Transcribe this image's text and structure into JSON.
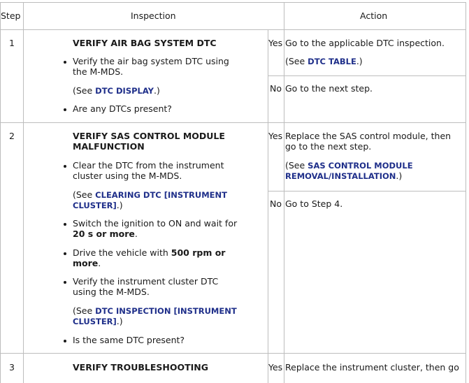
{
  "header": {
    "step": "Step",
    "inspection": "Inspection",
    "action": "Action"
  },
  "rows": [
    {
      "step": "1",
      "title": "VERIFY AIR BAG SYSTEM DTC",
      "b1": [
        "Verify the air bag system DTC using",
        "the M-MDS."
      ],
      "see1": {
        "pre": "(See ",
        "link": "DTC DISPLAY",
        "post": ".)"
      },
      "b2": "Are any DTCs present?",
      "yes_label": "Yes",
      "yes_text": "Go to the applicable DTC inspection.",
      "yes_see": {
        "pre": "(See ",
        "link": "DTC TABLE",
        "post": ".)"
      },
      "no_label": "No",
      "no_text": "Go to the next step."
    },
    {
      "step": "2",
      "title": [
        "VERIFY SAS CONTROL MODULE",
        "MALFUNCTION"
      ],
      "b1": [
        "Clear the DTC from the instrument",
        "cluster using the M-MDS."
      ],
      "see1": {
        "pre": "(See ",
        "link1": "CLEARING DTC [INSTRUMENT",
        "link2": "CLUSTER]",
        "post": ".)"
      },
      "b2": {
        "l1": "Switch the ignition to ON and wait for",
        "bold": "20 s or more",
        "post": "."
      },
      "b3": {
        "pre": "Drive the vehicle with ",
        "bold1": "500 rpm or",
        "bold2": "more",
        "post": "."
      },
      "b4": [
        "Verify the instrument cluster DTC",
        "using the M-MDS."
      ],
      "see2": {
        "pre": "(See ",
        "link1": "DTC INSPECTION [INSTRUMENT",
        "link2": "CLUSTER]",
        "post": ".)"
      },
      "b5": "Is the same DTC present?",
      "yes_label": "Yes",
      "yes_text": [
        "Replace the SAS control module, then",
        "go to the next step."
      ],
      "yes_see": {
        "pre": "(See ",
        "link1": "SAS CONTROL MODULE",
        "link2": "REMOVAL/INSTALLATION",
        "post": ".)"
      },
      "no_label": "No",
      "no_text": "Go to Step 4."
    },
    {
      "step": "3",
      "title": "VERIFY TROUBLESHOOTING",
      "yes_label": "Yes",
      "yes_text": "Replace the instrument cluster, then go"
    }
  ]
}
